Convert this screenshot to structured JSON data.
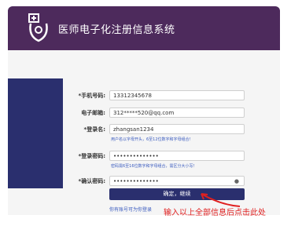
{
  "header": {
    "title": "医师电子化注册信息系统"
  },
  "form": {
    "phone_label": "*手机号码:",
    "phone_value": "13312345678",
    "email_label": "电子邮箱:",
    "email_value": "312*****520@qq.com",
    "username_label": "*登录名:",
    "username_value": "zhangsan1234",
    "username_hint": "用户名以字母开头，6至12位数字和字母组合！",
    "password_label": "*登录密码:",
    "password_value": "••••••••••••••",
    "password_hint": "密码需6至16位数字和字母组合，需区分大小写！",
    "confirm_label": "*确认密码:",
    "confirm_value": "••••••••••••••",
    "submit_label": "确定，继续",
    "link_text": "你有账号可为你登录"
  },
  "annotation": {
    "text": "输入以上全部信息后点击此处",
    "color": "#e02020"
  }
}
